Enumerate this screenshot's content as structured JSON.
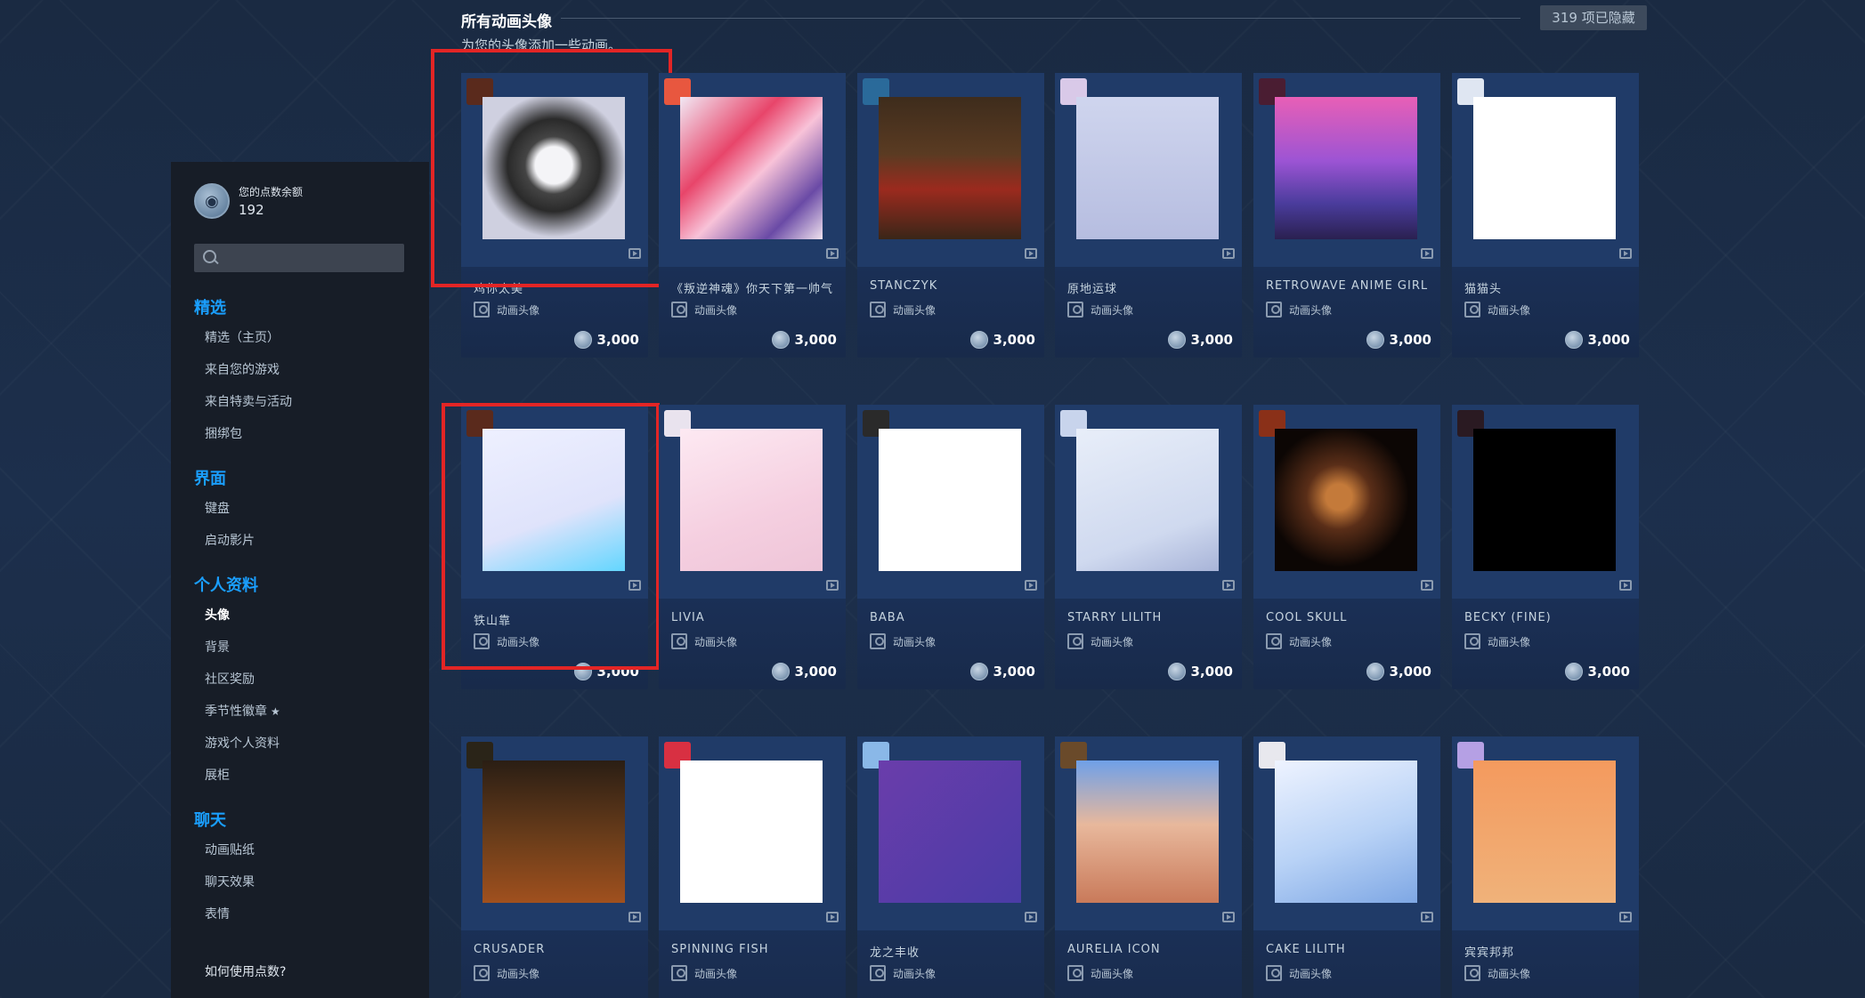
{
  "sidebar": {
    "balance_label": "您的点数余额",
    "balance_value": "192",
    "search_placeholder": "",
    "sections": [
      {
        "title": "精选",
        "items": [
          "精选（主页）",
          "来自您的游戏",
          "来自特卖与活动",
          "捆绑包"
        ]
      },
      {
        "title": "界面",
        "items": [
          "键盘",
          "启动影片"
        ]
      },
      {
        "title": "个人资料",
        "items": [
          "头像",
          "背景",
          "社区奖励",
          "季节性徽章",
          "游戏个人资料",
          "展柜"
        ]
      },
      {
        "title": "聊天",
        "items": [
          "动画贴纸",
          "聊天效果",
          "表情"
        ]
      }
    ],
    "active_item": "头像",
    "help_link": "如何使用点数?"
  },
  "header": {
    "title": "所有动画头像",
    "subtitle": "为您的头像添加一些动画。",
    "hidden_count": "319 项已隐藏"
  },
  "item_type_label": "动画头像",
  "items": [
    {
      "name": "鸡你太美",
      "price": "3,000",
      "highlighted": true
    },
    {
      "name": "《叛逆神魂》你天下第一帅气",
      "price": "3,000",
      "highlighted": false
    },
    {
      "name": "STAŃCZYK",
      "price": "3,000",
      "highlighted": false
    },
    {
      "name": "原地运球",
      "price": "3,000",
      "highlighted": false
    },
    {
      "name": "RETROWAVE ANIME GIRL",
      "price": "3,000",
      "highlighted": false
    },
    {
      "name": "猫猫头",
      "price": "3,000",
      "highlighted": false
    },
    {
      "name": "铁山靠",
      "price": "3,000",
      "highlighted": true
    },
    {
      "name": "LIVIA",
      "price": "3,000",
      "highlighted": false
    },
    {
      "name": "BABA",
      "price": "3,000",
      "highlighted": false
    },
    {
      "name": "STARRY LILITH",
      "price": "3,000",
      "highlighted": false
    },
    {
      "name": "COOL SKULL",
      "price": "3,000",
      "highlighted": false
    },
    {
      "name": "BECKY (FINE)",
      "price": "3,000",
      "highlighted": false
    },
    {
      "name": "CRUSADER",
      "price": "",
      "highlighted": false
    },
    {
      "name": "SPINNING FISH",
      "price": "",
      "highlighted": false
    },
    {
      "name": "龙之丰收",
      "price": "",
      "highlighted": false
    },
    {
      "name": "AURELIA ICON",
      "price": "",
      "highlighted": false
    },
    {
      "name": "CAKE LILITH",
      "price": "",
      "highlighted": false
    },
    {
      "name": "宾宾邦邦",
      "price": "",
      "highlighted": false
    }
  ],
  "colors": {
    "accent": "#1a9fff",
    "highlight_border": "#e32525",
    "sidebar_bg": "#171d27",
    "card_bg": "#1f3a66"
  },
  "icons": {
    "balance": "steam-points-coin-icon",
    "search": "search-icon",
    "animated": "play-icon",
    "type": "avatar-frame-icon",
    "price": "points-coin-icon"
  }
}
